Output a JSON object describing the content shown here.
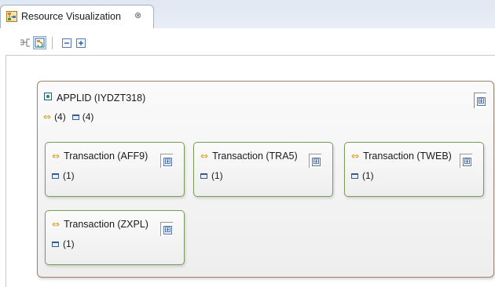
{
  "view_tab": {
    "title": "Resource Visualization",
    "close_glyph": "⊗",
    "icon": "resource-visualization-icon"
  },
  "toolbar": {
    "icons": [
      "layout-icon",
      "refresh-icon",
      "collapse-all-icon",
      "expand-all-icon"
    ]
  },
  "applid": {
    "title": "APPLID (IYDZT318)",
    "transaction_count": "(4)",
    "region_count": "(4)",
    "expand_glyph": "⊞"
  },
  "transactions": [
    {
      "label": "Transaction (AFF9)",
      "count": "(1)"
    },
    {
      "label": "Transaction (TRA5)",
      "count": "(1)"
    },
    {
      "label": "Transaction (TWEB)",
      "count": "(1)"
    },
    {
      "label": "Transaction (ZXPL)",
      "count": "(1)"
    }
  ],
  "colors": {
    "outer_border": "#9e8470",
    "card_border": "#7a9a5a",
    "transaction_arrow": "#d49a1a",
    "tab_bar": "#dfe7f2"
  }
}
